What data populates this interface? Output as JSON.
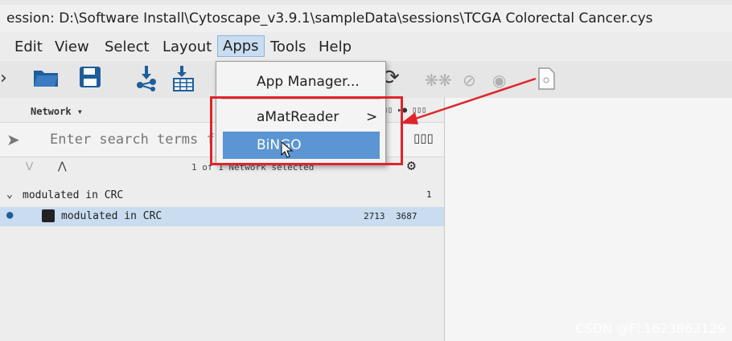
{
  "window": {
    "title": "ession: D:\\Software Install\\Cytoscape_v3.9.1\\sampleData\\sessions\\TCGA Colorectal Cancer.cys"
  },
  "menubar": {
    "items": [
      "Edit",
      "View",
      "Select",
      "Layout",
      "Apps",
      "Tools",
      "Help"
    ],
    "active": "Apps"
  },
  "apps_menu": {
    "items": [
      "App Manager...",
      "aMatReader",
      "BiNGO"
    ],
    "submenu_arrow": ">",
    "hover": "BiNGO"
  },
  "network_panel": {
    "tab_label": "Network ▾",
    "search_placeholder": "Enter search terms f",
    "search_glyph": "▯▯▯",
    "selection_status": "1 of 1 Network selected",
    "header_glyph": "▯▯ ▸● ▯▯▯",
    "tree": {
      "parent": {
        "name": "modulated in CRC",
        "count": "1"
      },
      "child": {
        "name": "modulated in CRC",
        "nodes": "2713",
        "edges": "3687"
      }
    }
  },
  "annotation": {
    "color": "#e0242a"
  },
  "watermark": "CSDN @FL1623863129"
}
